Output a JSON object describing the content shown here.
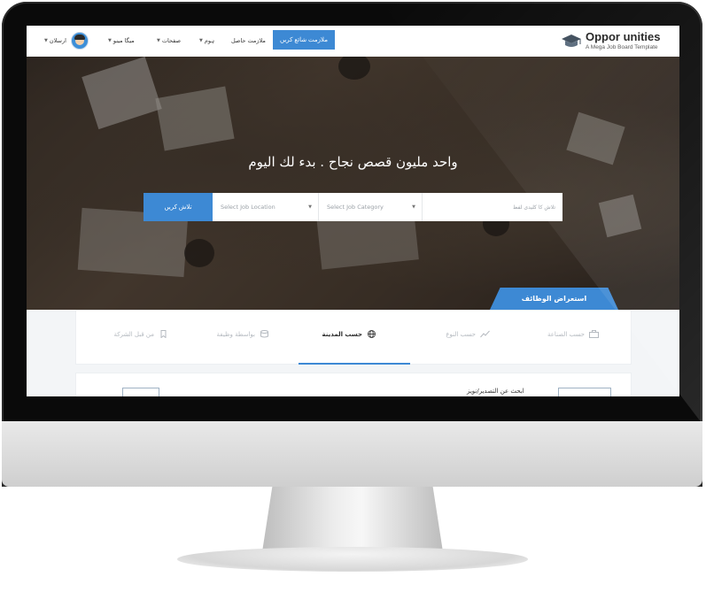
{
  "nav": {
    "logo_title": "Oppor  unities",
    "logo_subtitle": "A Mega Job Board Template",
    "post_job_label": "ملازمت شائع کریں",
    "menu": [
      {
        "label": "ملازمت حاصل",
        "has_caret": false
      },
      {
        "label": "ہوم",
        "has_caret": true
      },
      {
        "label": "صفحات",
        "has_caret": true
      },
      {
        "label": "میگا مینو",
        "has_caret": true
      },
      {
        "label": "ارسلان",
        "has_caret": true
      }
    ]
  },
  "hero": {
    "title": "واحد مليون قصص نجاح . بدء لك اليوم",
    "search": {
      "keyword_placeholder": "تلاش کا کلیدی لفظ",
      "category_placeholder": "Select Job Category",
      "location_placeholder": "Select Job Location",
      "button_label": "تلاش کریں"
    },
    "browse_tab_label": "استعراض الوظائف"
  },
  "tabs": [
    {
      "label": "حسب الصناعة",
      "icon": "briefcase-icon",
      "active": false
    },
    {
      "label": "حسب النوع",
      "icon": "chart-line-icon",
      "active": false
    },
    {
      "label": "حسب المدينة",
      "icon": "globe-icon",
      "active": true
    },
    {
      "label": "بواسطة وظيفة",
      "icon": "database-icon",
      "active": false
    },
    {
      "label": "من قبل الشركة",
      "icon": "bookmark-icon",
      "active": false
    }
  ],
  "card2": {
    "text": "ابحث عن التصدير/نويز"
  },
  "colors": {
    "accent": "#3d89d4",
    "nav_bg": "#ffffff",
    "bezel": "#0a0a0a"
  }
}
